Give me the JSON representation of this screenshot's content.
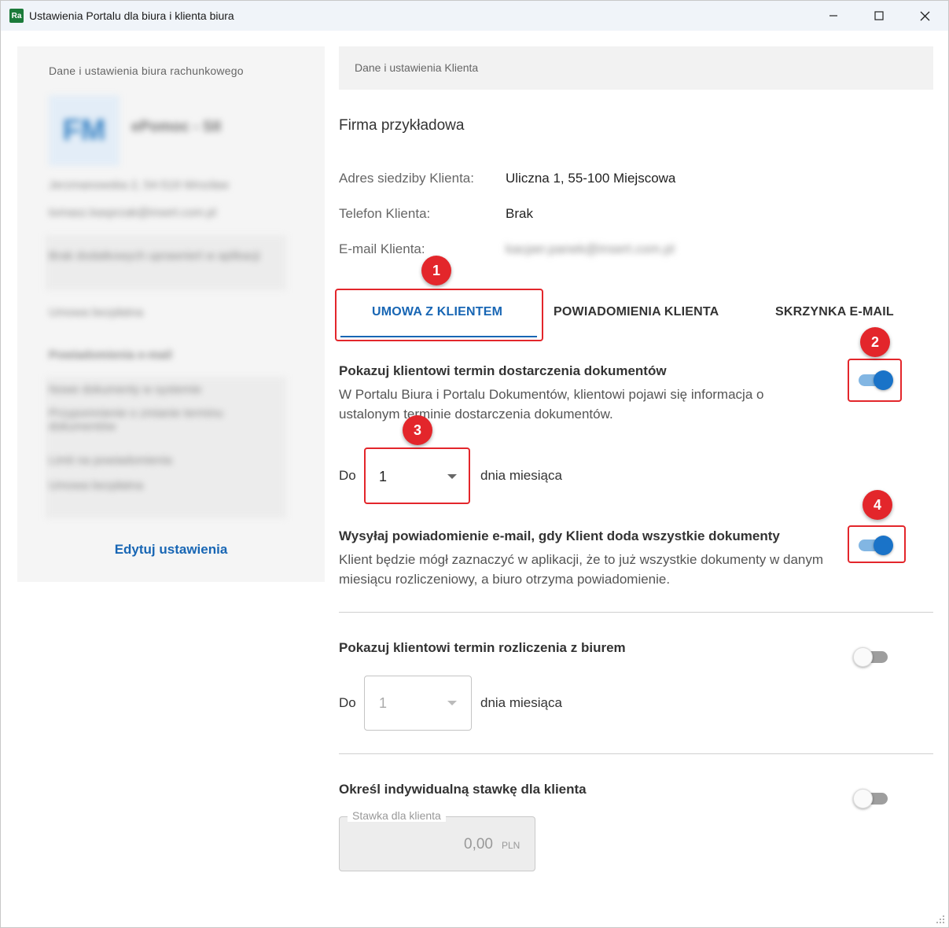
{
  "window": {
    "app_icon_text": "Ra",
    "title": "Ustawienia Portalu dla biura i klienta biura"
  },
  "left": {
    "heading": "Dane i ustawienia biura rachunkowego",
    "avatar_initials": "FM",
    "office_name": "ePomoc - SII",
    "address": "Jerzmanowska 2, 54-519 Wrocław",
    "email": "tomasz.kasprzak@insert.com.pl",
    "blurred_lines": [
      "Brak dodatkowych uprawnień w aplikacji",
      "Umowa bezpłatna",
      "Powiadomienia e-mail",
      "Nowe dokumenty w systemie",
      "Przypomnienie o zmianie terminu dokumentów",
      "Limit na powiadomienia",
      "Umowa bezpłatna"
    ],
    "edit_link": "Edytuj ustawienia"
  },
  "client": {
    "header": "Dane i ustawienia Klienta",
    "company_name": "Firma przykładowa",
    "address_label": "Adres siedziby Klienta:",
    "address_value": "Uliczna 1, 55-100 Miejscowa",
    "phone_label": "Telefon Klienta:",
    "phone_value": "Brak",
    "email_label": "E-mail Klienta:",
    "email_value": "kacper.panek@insert.com.pl"
  },
  "tabs": [
    {
      "label": "UMOWA Z KLIENTEM",
      "active": true
    },
    {
      "label": "POWIADOMIENIA KLIENTA",
      "active": false
    },
    {
      "label": "SKRZYNKA E-MAIL",
      "active": false
    }
  ],
  "settings": {
    "delivery_deadline": {
      "title": "Pokazuj klientowi termin dostarczenia dokumentów",
      "description": "W Portalu Biura i Portalu Dokumentów, klientowi pojawi się informacja o ustalonym terminie dostarczenia dokumentów.",
      "enabled": true,
      "prefix": "Do",
      "day": "1",
      "suffix": "dnia miesiąca"
    },
    "all_documents_notification": {
      "title": "Wysyłaj powiadomienie e-mail, gdy Klient doda wszystkie dokumenty",
      "description": "Klient będzie mógł zaznaczyć w aplikacji, że to już wszystkie dokumenty w danym miesiącu rozliczeniowy, a biuro otrzyma powiadomienie.",
      "enabled": true
    },
    "settlement_deadline": {
      "title": "Pokazuj klientowi termin rozliczenia z biurem",
      "enabled": false,
      "prefix": "Do",
      "day": "1",
      "suffix": "dnia miesiąca"
    },
    "individual_rate": {
      "title": "Określ indywidualną stawkę dla klienta",
      "enabled": false,
      "field_label": "Stawka dla klienta",
      "value": "0,00",
      "currency": "PLN"
    }
  },
  "annotations": [
    "1",
    "2",
    "3",
    "4"
  ],
  "colors": {
    "accent": "#1866b4",
    "toggle_on": "#1a73c8",
    "annotation_red": "#e3262b"
  }
}
